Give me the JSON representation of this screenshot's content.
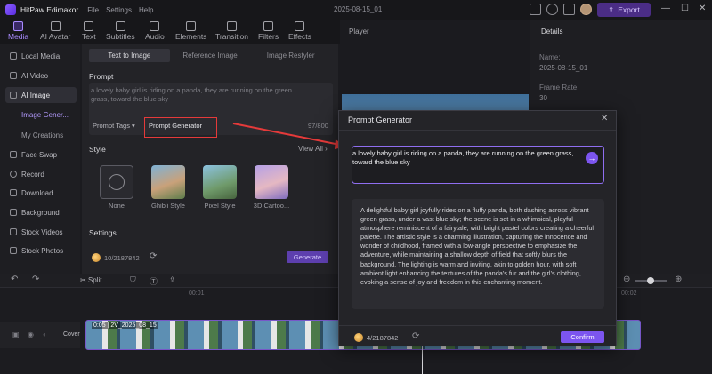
{
  "app": {
    "title": "HitPaw Edimakor",
    "menu": [
      "File",
      "Settings",
      "Help"
    ],
    "document_name": "2025-08-15_01",
    "export_label": "Export"
  },
  "toolbar": {
    "tabs": [
      "Media",
      "AI Avatar",
      "Text",
      "Subtitles",
      "Audio",
      "Elements",
      "Transition",
      "Filters",
      "Effects"
    ],
    "active": "Media"
  },
  "sidebar": {
    "items": [
      {
        "label": "Local Media"
      },
      {
        "label": "AI Video"
      },
      {
        "label": "AI Image"
      },
      {
        "label": "Face Swap"
      },
      {
        "label": "Record"
      },
      {
        "label": "Download"
      },
      {
        "label": "Background"
      },
      {
        "label": "Stock Videos"
      },
      {
        "label": "Stock Photos"
      }
    ],
    "subitems": [
      "Image Gener...",
      "My Creations"
    ],
    "active_subitem": "Image Gener..."
  },
  "panel": {
    "tabs": [
      "Text to Image",
      "Reference Image",
      "Image Restyler"
    ],
    "active_tab": "Text to Image",
    "prompt_label": "Prompt",
    "prompt_text": "a lovely baby girl is riding on a panda, they are running on the green grass, toward the blue sky",
    "prompt_tags_label": "Prompt Tags",
    "prompt_generator_label": "Prompt Generator",
    "char_count": "97/800",
    "style_label": "Style",
    "view_all_label": "View All",
    "styles": [
      "None",
      "Ghibli Style",
      "Pixel Style",
      "3D Cartoo..."
    ],
    "settings_label": "Settings",
    "credits": "10/2187842",
    "generate_label": "Generate"
  },
  "player": {
    "title": "Player"
  },
  "details": {
    "tab": "Details",
    "name_label": "Name:",
    "name_value": "2025-08-15_01",
    "frame_rate_label": "Frame Rate:",
    "frame_rate_value": "30"
  },
  "timeline": {
    "split_label": "Split",
    "time_marks": [
      "00:01",
      "00:02"
    ],
    "track_label": "Cover",
    "clip_label": "0:05 | 2V_2025_08_15"
  },
  "modal": {
    "title": "Prompt Generator",
    "input_text": "a lovely baby girl is riding on a panda, they are running on the green grass, toward the blue sky",
    "result_text": "A delightful baby girl joyfully rides on a fluffy panda, both dashing across vibrant green grass, under a vast blue sky; the scene is set in a whimsical, playful atmosphere reminiscent of a fairytale, with bright pastel colors creating a cheerful palette. The artistic style is a charming illustration, capturing the innocence and wonder of childhood, framed with a low-angle perspective to emphasize the adventure, while maintaining a shallow depth of field that softly blurs the background. The lighting is warm and inviting, akin to golden hour, with soft ambient light enhancing the textures of the panda's fur and the girl’s clothing, evoking a sense of joy and freedom in this enchanting moment.",
    "credits": "4/2187842",
    "confirm_label": "Confirm"
  },
  "colors": {
    "accent": "#7c55ef",
    "highlight": "#e53a3a",
    "background": "#1b1b1f"
  }
}
